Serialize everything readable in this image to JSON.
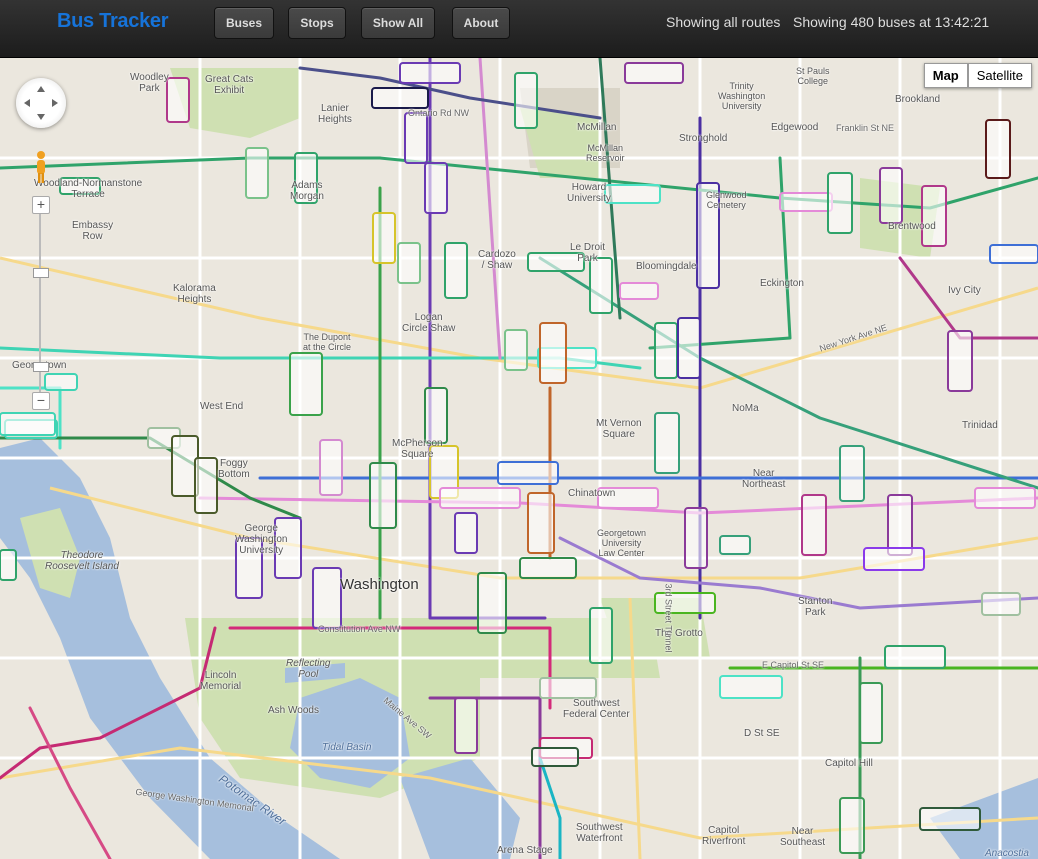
{
  "header": {
    "brand": "Bus Tracker",
    "nav": [
      "Buses",
      "Stops",
      "Show All",
      "About"
    ],
    "routes_status": "Showing all routes",
    "buses_status": "Showing 480 buses at 13:42:21"
  },
  "map_controls": {
    "map_label": "Map",
    "satellite_label": "Satellite",
    "zoom_in": "+",
    "zoom_out": "−"
  },
  "map_labels": {
    "woodley_park": "Woodley\nPark",
    "great_cats": "Great Cats\nExhibit",
    "lanier": "Lanier\nHeights",
    "ontario": "Ontario Rd NW",
    "mcmillan": "McMillan",
    "mcmillan_res": "McMillan\nReservoir",
    "stronghold": "Stronghold",
    "trinity": "Trinity\nWashington\nUniversity",
    "st_pauls": "St Pauls\nCollege",
    "brookland": "Brookland",
    "edgewood": "Edgewood",
    "franklin": "Franklin St NE",
    "woodland": "Woodland-Normanstone\nTerrace",
    "embassy": "Embassy\nRow",
    "kalorama": "Kalorama\nHeights",
    "adams": "Adams\nMorgan",
    "howard": "Howard\nUniversity",
    "glenwood": "Glenwood\nCemetery",
    "brentwood": "Brentwood",
    "ledroit": "Le Droit\nPark",
    "bloomingdale": "Bloomingdale",
    "eckington": "Eckington",
    "ivy_city": "Ivy City",
    "georgetown": "Georgetown",
    "dupont": "The Dupont\nat the Circle",
    "logan": "Logan\nCircle Shaw",
    "shaw": "Cardozo\n/ Shaw",
    "ny_ave": "New York Ave NE",
    "noma": "NoMa",
    "trinidad": "Trinidad",
    "west_end": "West End",
    "mcpherson": "McPherson\nSquare",
    "mt_vernon": "Mt Vernon\nSquare",
    "foggy": "Foggy\nBottom",
    "chinatown": "Chinatown",
    "near_ne": "Near\nNortheast",
    "gwu": "George\nWashington\nUniversity",
    "gtlaw": "Georgetown\nUniversity\nLaw Center",
    "washington": "Washington",
    "theodore": "Theodore\nRoosevelt Island",
    "stanton": "Stanton\nPark",
    "grotto": "The Grotto",
    "constitution": "Constitution Ave NW",
    "reflecting": "Reflecting\nPool",
    "lincoln": "Lincoln\nMemorial",
    "ash": "Ash Woods",
    "tidal": "Tidal Basin",
    "southwest": "Southwest\nFederal Center",
    "d_st_se": "D St SE",
    "e_capitol": "E Capitol St SE",
    "capitol_hill": "Capitol Hill",
    "potomac": "Potomac River",
    "gw_mem": "George Washington Memorial",
    "sw_waterfront": "Southwest\nWaterfront",
    "capitol_riverfront": "Capitol\nRiverfront",
    "near_se": "Near\nSoutheast",
    "arena": "Arena Stage",
    "anacostia": "Anacostia",
    "maine": "Maine Ave SW",
    "third_tunnel": "3rd Street Tunnel"
  },
  "colors": {
    "water": "#a6bfdd",
    "park": "#cfe0b2",
    "land": "#ebe7de",
    "brand": "#1673d9"
  }
}
